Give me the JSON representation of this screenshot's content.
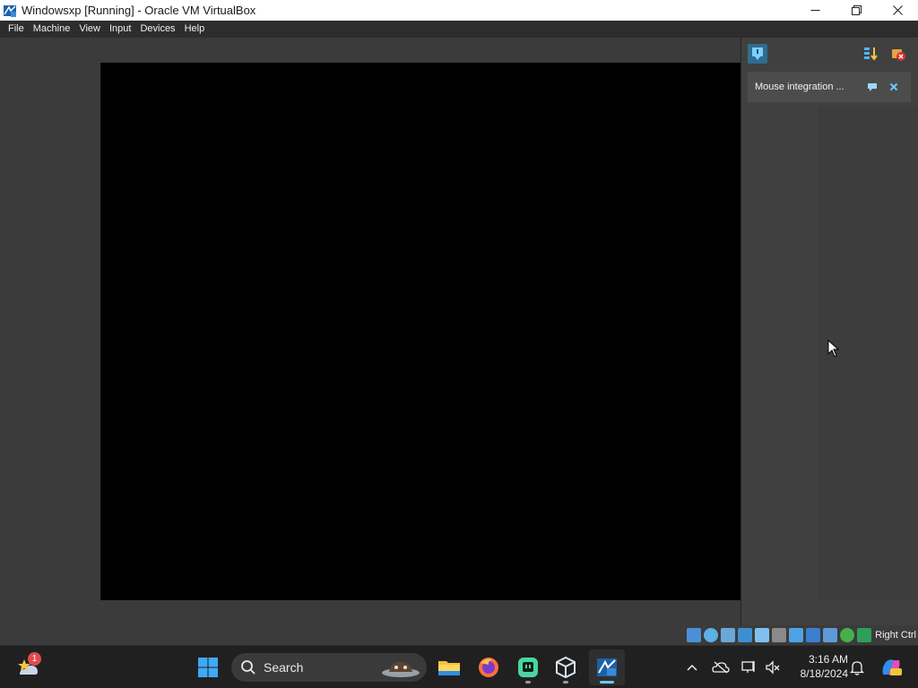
{
  "window": {
    "title": "Windowsxp [Running] - Oracle VM VirtualBox"
  },
  "menu": {
    "items": [
      "File",
      "Machine",
      "View",
      "Input",
      "Devices",
      "Help"
    ]
  },
  "notification_panel": {
    "message": "Mouse integration ..."
  },
  "statusbar": {
    "host_key": "Right Ctrl"
  },
  "taskbar": {
    "search_placeholder": "Search",
    "weather_badge": "1",
    "clock_time": "3:16 AM",
    "clock_date": "8/18/2024"
  },
  "colors": {
    "accent": "#6cc6ff",
    "vm_screen": "#000000",
    "panel_bg": "#404040"
  }
}
